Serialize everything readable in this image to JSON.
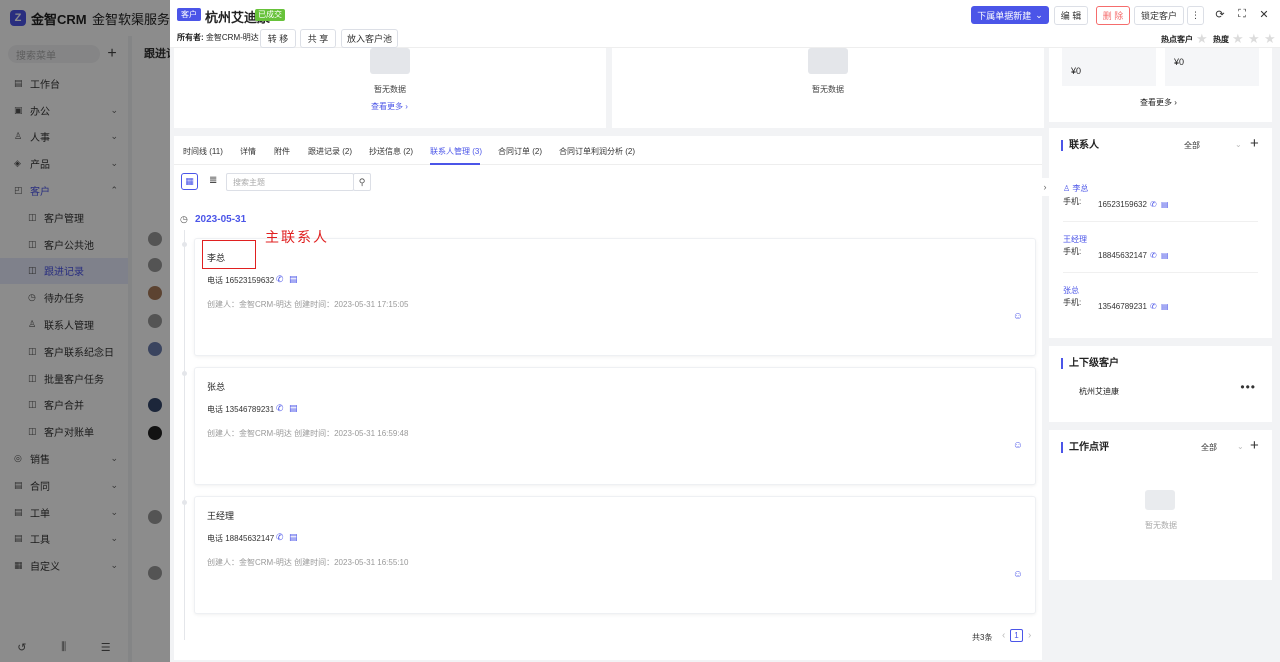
{
  "bg": {
    "logo_mark": "Z",
    "logo": "金智CRM",
    "company": "金智软渠服务中心",
    "search_placeholder": "搜索菜单",
    "plus": "+",
    "main_title": "跟进记录",
    "menu": [
      {
        "icon": "▤",
        "label": "工作台",
        "arrow": ""
      },
      {
        "icon": "▣",
        "label": "办公",
        "arrow": "⌄"
      },
      {
        "icon": "♙",
        "label": "人事",
        "arrow": "⌄"
      },
      {
        "icon": "◈",
        "label": "产品",
        "arrow": "⌄"
      },
      {
        "icon": "◰",
        "label": "客户",
        "arrow": "⌃"
      },
      {
        "icon": "◫",
        "label": "客户管理",
        "arrow": ""
      },
      {
        "icon": "◫",
        "label": "客户公共池",
        "arrow": ""
      },
      {
        "icon": "◫",
        "label": "跟进记录",
        "arrow": ""
      },
      {
        "icon": "◷",
        "label": "待办任务",
        "arrow": ""
      },
      {
        "icon": "♙",
        "label": "联系人管理",
        "arrow": ""
      },
      {
        "icon": "◫",
        "label": "客户联系纪念日",
        "arrow": ""
      },
      {
        "icon": "◫",
        "label": "批量客户任务",
        "arrow": ""
      },
      {
        "icon": "◫",
        "label": "客户合并",
        "arrow": ""
      },
      {
        "icon": "◫",
        "label": "客户对账单",
        "arrow": ""
      },
      {
        "icon": "◎",
        "label": "销售",
        "arrow": "⌄"
      },
      {
        "icon": "▤",
        "label": "合同",
        "arrow": "⌄"
      },
      {
        "icon": "▤",
        "label": "工单",
        "arrow": "⌄"
      },
      {
        "icon": "▤",
        "label": "工具",
        "arrow": "⌄"
      },
      {
        "icon": "▦",
        "label": "自定义",
        "arrow": "⌄"
      }
    ],
    "bottom_icons": [
      "↺",
      "⫼",
      "☰"
    ]
  },
  "header": {
    "tag": "客户",
    "title": "杭州艾迪康",
    "status": "已成交",
    "owner_label": "所有者:",
    "owner": "金智CRM-明达",
    "btn_transfer": "转 移",
    "btn_share": "共 享",
    "btn_pool": "放入客户池",
    "btn_create": "下属单据新建",
    "btn_create_caret": "⌄",
    "btn_edit": "编 辑",
    "btn_delete": "删 除",
    "btn_lock": "锁定客户",
    "icon_more": "⋮",
    "icon_refresh": "⟳",
    "icon_expand": "⛶",
    "icon_close": "✕",
    "hot_customer": "热点客户",
    "heat": "热度",
    "star": "★"
  },
  "top_cards": {
    "empty": "暂无数据",
    "more": "查看更多 ›"
  },
  "tabs": [
    "时间线 (11)",
    "详情",
    "附件",
    "跟进记录 (2)",
    "抄送信息 (2)",
    "联系人管理 (3)",
    "合同订单 (2)",
    "合同订单利润分析 (2)"
  ],
  "toolbar": {
    "view_card": "▦",
    "view_list": "≣",
    "search_placeholder": "搜索主题",
    "search_icon": "⚲"
  },
  "timeline": {
    "date_icon": "◷",
    "date": "2023-05-31",
    "annotation": "主联系人",
    "phone_icon": "✆",
    "msg_icon": "▤",
    "smile_icon": "☺",
    "contacts": [
      {
        "name": "李总",
        "phone": "电话 16523159632",
        "meta": "创建人：金智CRM-明达    创建时间：2023-05-31 17:15:05"
      },
      {
        "name": "张总",
        "phone": "电话 13546789231",
        "meta": "创建人：金智CRM-明达    创建时间：2023-05-31 16:59:48"
      },
      {
        "name": "王经理",
        "phone": "电话 18845632147",
        "meta": "创建人：金智CRM-明达    创建时间：2023-05-31 16:55:10"
      }
    ]
  },
  "pager": {
    "total": "共3条",
    "prev": "‹",
    "current": "1",
    "next": "›"
  },
  "right": {
    "money_a": "¥0",
    "money_b": "¥0",
    "more": "查看更多 ›",
    "contacts_title": "联系人",
    "filter_all": "全部",
    "chevron": "⌄",
    "plus": "+",
    "phone_label": "手机:",
    "phone_icon": "✆",
    "msg_icon": "▤",
    "main_contact_icon": "♙",
    "contacts": [
      {
        "name": "李总",
        "phone": "16523159632"
      },
      {
        "name": "王经理",
        "phone": "18845632147"
      },
      {
        "name": "张总",
        "phone": "13546789231"
      }
    ],
    "parent_title": "上下级客户",
    "parent_name": "杭州艾迪康",
    "parent_more": "•••",
    "review_title": "工作点评",
    "review_empty": "暂无数据"
  },
  "collapse_icon": "›"
}
